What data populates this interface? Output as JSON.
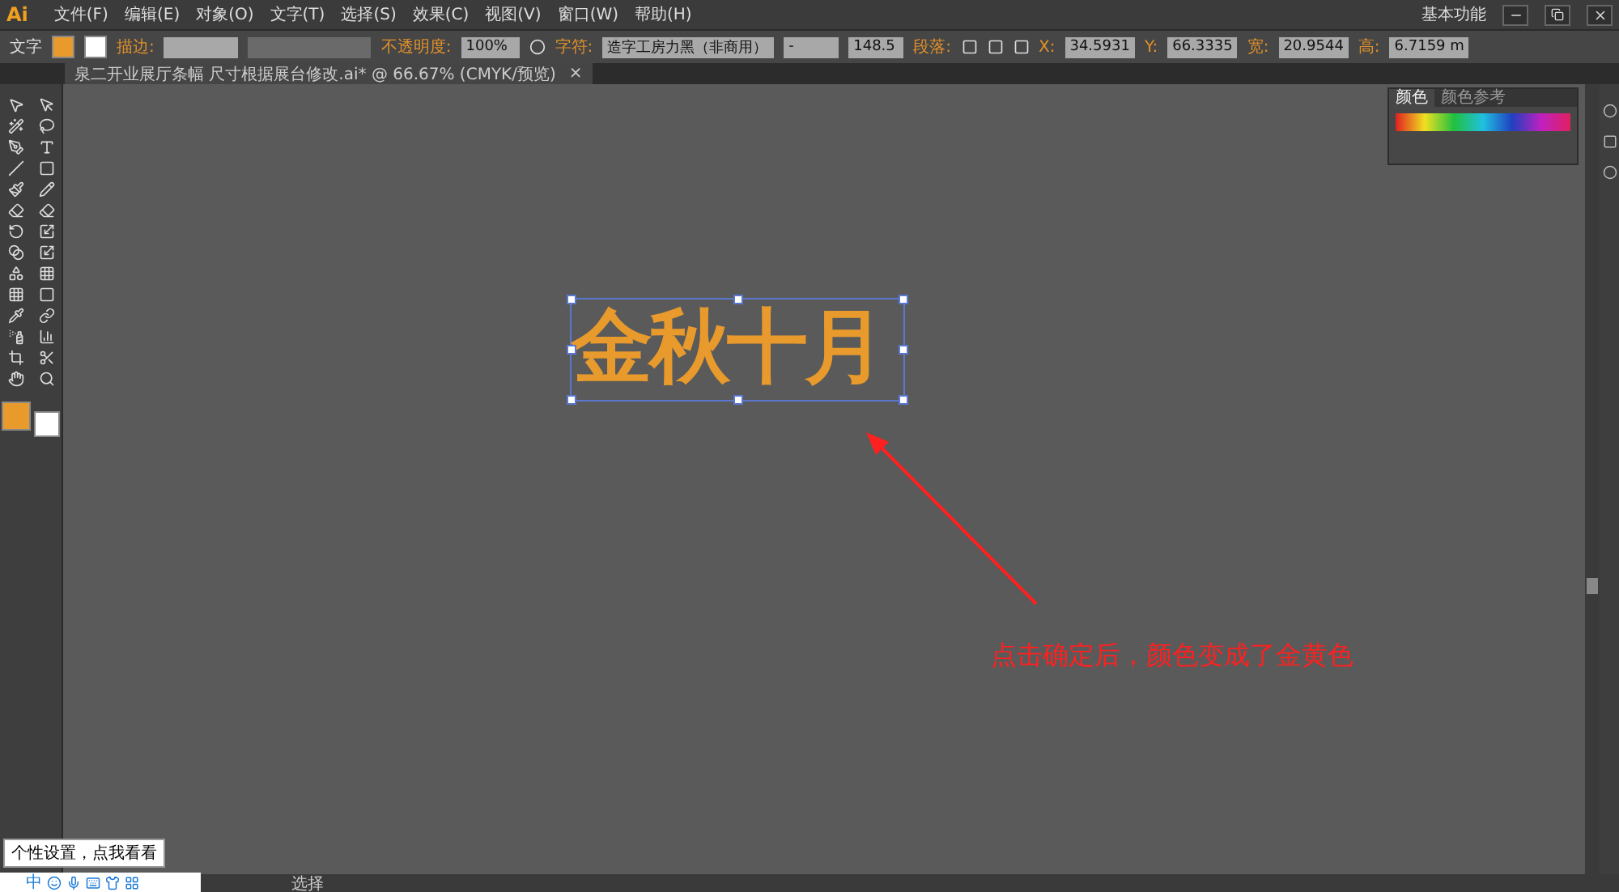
{
  "menu_bar": {
    "logo": "Ai",
    "menus": [
      "文件(F)",
      "编辑(E)",
      "对象(O)",
      "文字(T)",
      "选择(S)",
      "效果(C)",
      "视图(V)",
      "窗口(W)",
      "帮助(H)"
    ],
    "workspace": "基本功能"
  },
  "control_bar": {
    "mode": "文字",
    "stroke_label": "描边:",
    "opacity_label": "不透明度:",
    "opacity": "100%",
    "character_label": "字符:",
    "font": "造字工房力黑（非商用）",
    "font_style": "-",
    "font_size": "148.5",
    "paragraph_label": "段落:",
    "fields": [
      {
        "label": "X:",
        "value": "34.5931"
      },
      {
        "label": "Y:",
        "value": "66.3335"
      },
      {
        "label": "宽:",
        "value": "20.9544"
      },
      {
        "label": "高:",
        "value": "6.7159 m"
      }
    ]
  },
  "document_tab": {
    "title": "泉二开业展厅条幅 尺寸根据展台修改.ai* @ 66.67% (CMYK/预览)",
    "close": "×"
  },
  "color_panel": {
    "tabs": [
      {
        "label": "颜色",
        "selected": true
      },
      {
        "label": "颜色参考",
        "selected": false
      }
    ]
  },
  "canvas": {
    "text": "金秋十月",
    "annotation": "点击确定后，颜色变成了金黄色"
  },
  "status_bar": {
    "tool": "选择"
  },
  "ime": {
    "tooltip": "个性设置，点我看看",
    "mode": "中"
  }
}
